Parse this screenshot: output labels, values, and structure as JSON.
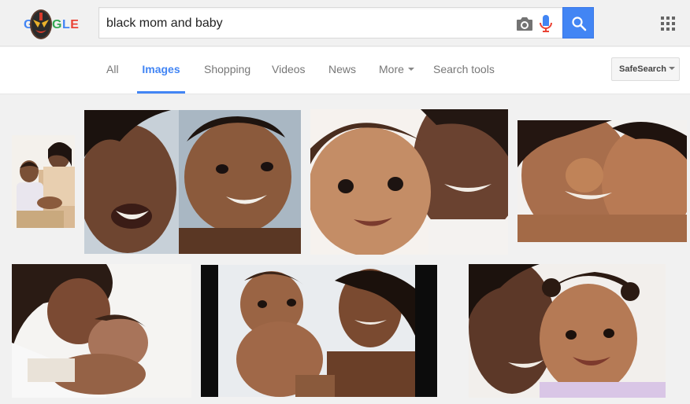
{
  "search": {
    "query": "black mom and baby"
  },
  "tabs": {
    "all": "All",
    "images": "Images",
    "shopping": "Shopping",
    "videos": "Videos",
    "news": "News",
    "more": "More",
    "search_tools": "Search tools"
  },
  "safesearch": {
    "label": "SafeSearch"
  },
  "logo": {
    "text": "GOOGLE"
  },
  "colors": {
    "accent": "#4285f4",
    "background": "#f1f1f1"
  },
  "icons": [
    "camera-icon",
    "mic-icon",
    "search-icon",
    "apps-grid-icon",
    "chevron-down-icon"
  ],
  "results": {
    "count": 7
  }
}
